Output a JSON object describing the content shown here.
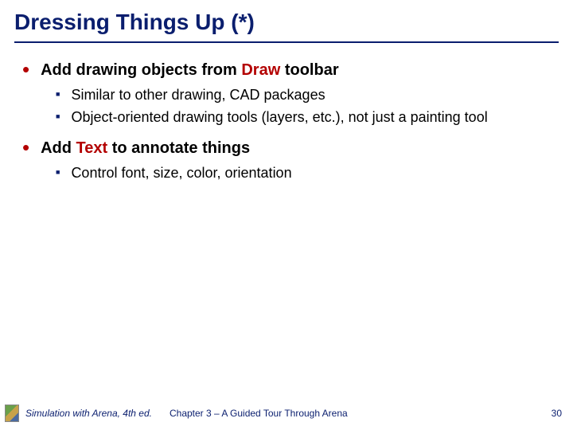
{
  "title": "Dressing Things Up (*)",
  "bullets": {
    "b1": {
      "pre": "Add drawing objects from ",
      "accent": "Draw",
      "post": " toolbar",
      "sub1": "Similar to other drawing, CAD packages",
      "sub2": "Object-oriented drawing tools (layers, etc.), not just a painting tool"
    },
    "b2": {
      "pre": "Add ",
      "accent": "Text",
      "post": " to annotate things",
      "sub1": "Control font, size, color, orientation"
    }
  },
  "footer": {
    "book": "Simulation with Arena, 4th ed.",
    "chapter": "Chapter 3 – A Guided Tour Through Arena",
    "page": "30"
  }
}
